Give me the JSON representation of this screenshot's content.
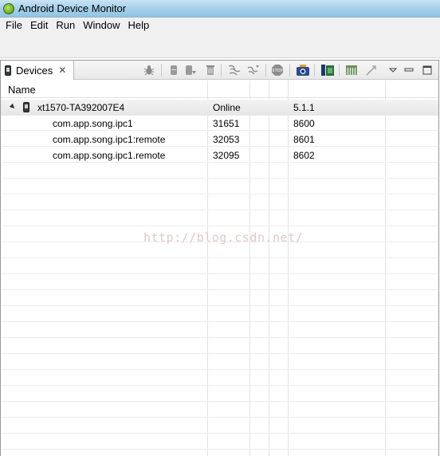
{
  "window": {
    "title": "Android Device Monitor"
  },
  "menu": {
    "items": [
      "File",
      "Edit",
      "Run",
      "Window",
      "Help"
    ]
  },
  "devices_view": {
    "tab_label": "Devices",
    "columns": {
      "name": "Name"
    },
    "device": {
      "name": "xt1570-TA392007E4",
      "status": "Online",
      "version": "5.1.1"
    },
    "processes": [
      {
        "name": "com.app.song.ipc1",
        "pid": "31651",
        "port": "8600"
      },
      {
        "name": "com.app.song.ipc1:remote",
        "pid": "32053",
        "port": "8601"
      },
      {
        "name": "com.app.song.ipc1.remote",
        "pid": "32095",
        "port": "8602"
      }
    ]
  },
  "watermark": "http://blog.csdn.net/"
}
